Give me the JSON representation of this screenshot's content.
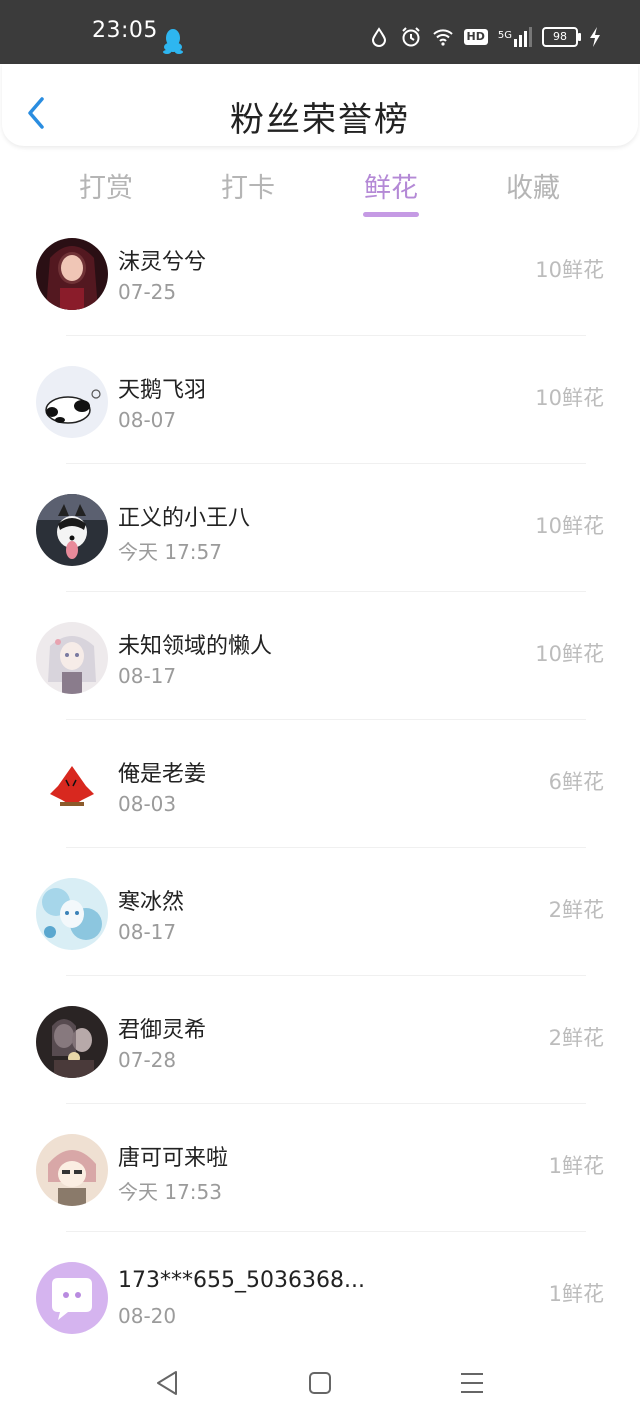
{
  "status_bar": {
    "time": "23:05",
    "battery": "98",
    "icons": [
      "qq-icon",
      "water-drop-icon",
      "alarm-icon",
      "wifi-icon",
      "hd-icon",
      "signal-5g-icon",
      "battery-icon",
      "charging-icon"
    ],
    "hd_label": "HD",
    "network_label": "5G"
  },
  "header": {
    "title": "粉丝荣誉榜",
    "back_icon": "chevron-left-icon"
  },
  "tabs": [
    {
      "label": "打赏",
      "active": false
    },
    {
      "label": "打卡",
      "active": false
    },
    {
      "label": "鲜花",
      "active": true
    },
    {
      "label": "收藏",
      "active": false
    }
  ],
  "colors": {
    "accent": "#b489d6",
    "status_bar_bg": "#3b3b3b",
    "back_icon": "#2a8de0"
  },
  "fans": [
    {
      "name": "沫灵兮兮",
      "date": "07-25",
      "count": "10鲜花",
      "avatar": "dark-girl-avatar"
    },
    {
      "name": "天鹅飞羽",
      "date": "08-07",
      "count": "10鲜花",
      "avatar": "panda-avatar"
    },
    {
      "name": "正义的小王八",
      "date": "今天 17:57",
      "count": "10鲜花",
      "avatar": "husky-avatar"
    },
    {
      "name": "未知领域的懒人",
      "date": "08-17",
      "count": "10鲜花",
      "avatar": "anime-girl-avatar"
    },
    {
      "name": "俺是老姜",
      "date": "08-03",
      "count": "6鲜花",
      "avatar": "red-logo-avatar"
    },
    {
      "name": "寒冰然",
      "date": "08-17",
      "count": "2鲜花",
      "avatar": "ice-avatar"
    },
    {
      "name": "君御灵希",
      "date": "07-28",
      "count": "2鲜花",
      "avatar": "couple-avatar"
    },
    {
      "name": "唐可可来啦",
      "date": "今天 17:53",
      "count": "1鲜花",
      "avatar": "cartoon-girl-avatar"
    },
    {
      "name": "173***655_5036368...",
      "date": "08-20",
      "count": "1鲜花",
      "avatar": "default-chat-avatar"
    }
  ],
  "navbar": {
    "icons": [
      "back-triangle-icon",
      "home-square-icon",
      "menu-lines-icon"
    ]
  }
}
